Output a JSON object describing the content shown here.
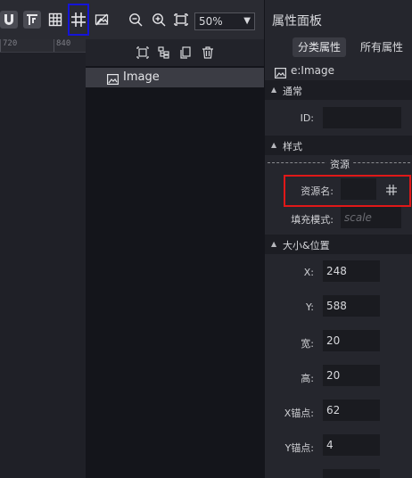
{
  "toolbar": {
    "zoom_value": "50%",
    "zoom_arrow": "▼"
  },
  "ruler": {
    "ticks": [
      "720",
      "840"
    ]
  },
  "outline": {
    "item_label": "Image"
  },
  "properties": {
    "title": "属性面板",
    "tabs": [
      "分类属性",
      "所有属性"
    ],
    "element_type": "e:Image",
    "sections": {
      "general": "通常",
      "style": "样式",
      "size_position": "大小&位置"
    },
    "general": {
      "id_label": "ID:",
      "id_value": ""
    },
    "style": {
      "resource_title": "资源",
      "resource_name_label": "资源名:",
      "resource_name_value": "",
      "fill_mode_label": "填充模式:",
      "fill_mode_placeholder": "scale"
    },
    "size_position": {
      "x_label": "X:",
      "x_value": "248",
      "y_label": "Y:",
      "y_value": "588",
      "width_label": "宽:",
      "width_value": "20",
      "height_label": "高:",
      "height_value": "20",
      "anchor_x_label": "X锚点:",
      "anchor_x_value": "62",
      "anchor_y_label": "Y锚点:",
      "anchor_y_value": "4"
    }
  }
}
